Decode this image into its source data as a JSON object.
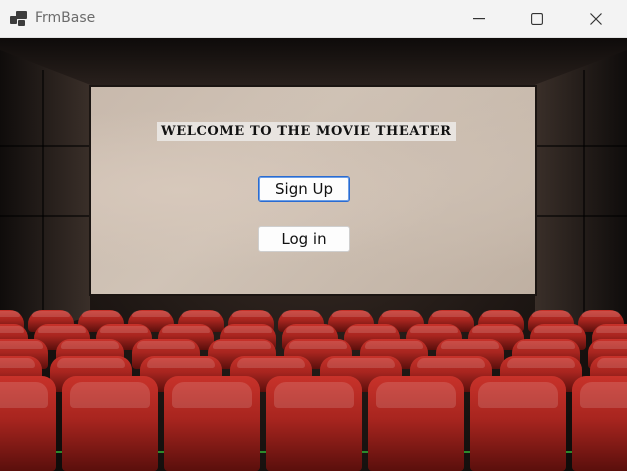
{
  "window": {
    "title": "FrmBase",
    "icons": {
      "app": "app-window-icon",
      "minimize": "minimize-icon",
      "maximize": "maximize-icon",
      "close": "close-icon"
    }
  },
  "theater": {
    "welcome_text": "WELCOME TO THE MOVIE THEATER",
    "signup_label": "Sign Up",
    "login_label": "Log in"
  },
  "colors": {
    "seat_red": "#c8322a",
    "seat_dark": "#5a0f0c",
    "screen": "#cbbcaf",
    "button_focus_border": "#2a6bd1"
  }
}
